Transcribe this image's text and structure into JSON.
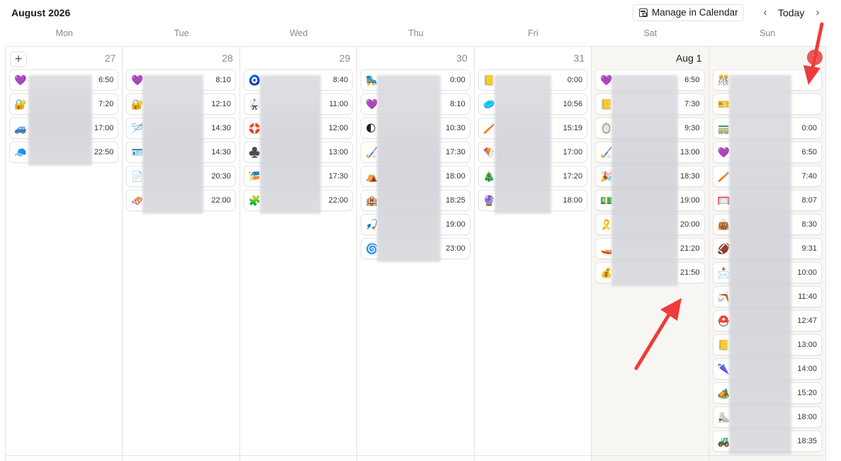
{
  "header": {
    "title": "August 2026",
    "manage_label": "Manage in Calendar",
    "today_label": "Today"
  },
  "weekdays": [
    "Mon",
    "Tue",
    "Wed",
    "Thu",
    "Fri",
    "Sat",
    "Sun"
  ],
  "days": [
    {
      "label": "27",
      "events": [
        {
          "emoji": "💜",
          "time": "6:50"
        },
        {
          "emoji": "🔐",
          "time": "7:20"
        },
        {
          "emoji": "🚙",
          "time": "17:00"
        },
        {
          "emoji": "🧢",
          "time": "22:50"
        }
      ]
    },
    {
      "label": "28",
      "events": [
        {
          "emoji": "💜",
          "time": "8:10"
        },
        {
          "emoji": "🔐",
          "time": "12:10"
        },
        {
          "emoji": "🪡",
          "time": "14:30"
        },
        {
          "emoji": "🪪",
          "time": "14:30"
        },
        {
          "emoji": "📄",
          "time": "20:30"
        },
        {
          "emoji": "🛷",
          "time": "22:00"
        }
      ]
    },
    {
      "label": "29",
      "events": [
        {
          "emoji": "🧿",
          "time": "8:40"
        },
        {
          "emoji": "🥋",
          "time": "11:00"
        },
        {
          "emoji": "🛟",
          "time": "12:00"
        },
        {
          "emoji": "♣️",
          "time": "13:00"
        },
        {
          "emoji": "🎏",
          "time": "17:30"
        },
        {
          "emoji": "🧩",
          "time": "22:00"
        }
      ]
    },
    {
      "label": "30",
      "events": [
        {
          "emoji": "🛼",
          "time": "0:00"
        },
        {
          "emoji": "💜",
          "time": "8:10"
        },
        {
          "emoji": "🌓",
          "time": "10:30"
        },
        {
          "emoji": "🏑",
          "time": "17:30"
        },
        {
          "emoji": "⛺",
          "time": "18:00"
        },
        {
          "emoji": "🏨",
          "time": "18:25"
        },
        {
          "emoji": "🎣",
          "time": "19:00"
        },
        {
          "emoji": "🌀",
          "time": "23:00"
        }
      ]
    },
    {
      "label": "31",
      "events": [
        {
          "emoji": "📒",
          "time": "0:00"
        },
        {
          "emoji": "🥏",
          "time": "10:56"
        },
        {
          "emoji": "🪥",
          "time": "15:19"
        },
        {
          "emoji": "🪁",
          "time": "17:00"
        },
        {
          "emoji": "🎄",
          "time": "17:20"
        },
        {
          "emoji": "🔮",
          "time": "18:00"
        }
      ]
    },
    {
      "label": "Aug 1",
      "events": [
        {
          "emoji": "💜",
          "time": "6:50"
        },
        {
          "emoji": "📒",
          "time": "7:30"
        },
        {
          "emoji": "🪞",
          "time": "9:30"
        },
        {
          "emoji": "🏑",
          "time": "13:00"
        },
        {
          "emoji": "🎉",
          "time": "18:30"
        },
        {
          "emoji": "💵",
          "time": "19:00"
        },
        {
          "emoji": "🎗️",
          "time": "20:00"
        },
        {
          "emoji": "🚤",
          "time": "21:20"
        },
        {
          "emoji": "💰",
          "time": "21:50"
        }
      ]
    },
    {
      "label": "2",
      "events": [
        {
          "emoji": "🎊",
          "time": ""
        },
        {
          "emoji": "🎫",
          "time": ""
        },
        {
          "emoji": "🚃",
          "time": "0:00"
        },
        {
          "emoji": "💜",
          "time": "6:50"
        },
        {
          "emoji": "🪥",
          "time": "7:40"
        },
        {
          "emoji": "🥅",
          "time": "8:07"
        },
        {
          "emoji": "👜",
          "time": "8:30"
        },
        {
          "emoji": "🏈",
          "time": "9:31"
        },
        {
          "emoji": "📩",
          "time": "10:00"
        },
        {
          "emoji": "🪃",
          "time": "11:40"
        },
        {
          "emoji": "⛑️",
          "time": "12:47"
        },
        {
          "emoji": "📒",
          "time": "13:00"
        },
        {
          "emoji": "🌂",
          "time": "14:00"
        },
        {
          "emoji": "🏕️",
          "time": "15:20"
        },
        {
          "emoji": "⛸️",
          "time": "18:00"
        },
        {
          "emoji": "🚜",
          "time": "18:35"
        }
      ]
    }
  ]
}
